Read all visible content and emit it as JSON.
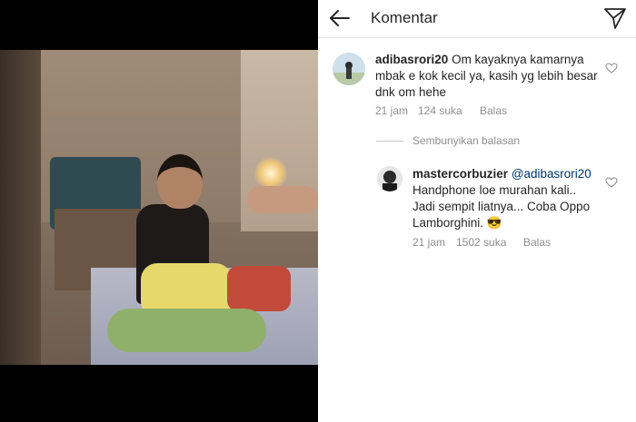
{
  "header": {
    "title": "Komentar"
  },
  "comments": [
    {
      "username": "adibasrori20",
      "text": "Om kayaknya kamarnya mbak e kok kecil ya, kasih yg lebih besar dnk om hehe",
      "time": "21 jam",
      "likes": "124 suka",
      "reply_label": "Balas"
    }
  ],
  "hide_replies_label": "Sembunyikan balasan",
  "replies": [
    {
      "username": "mastercorbuzier",
      "mention": "@adibasrori20",
      "text_line1": "Handphone loe murahan kali..",
      "text_line2": "Jadi sempit liatnya... Coba Oppo",
      "text_line3": "Lamborghini.",
      "emoji": "😎",
      "time": "21 jam",
      "likes": "1502 suka",
      "reply_label": "Balas"
    }
  ],
  "icons": {
    "back": "arrow-left-icon",
    "send": "paper-plane-icon",
    "like": "heart-outline-icon"
  },
  "colors": {
    "text": "#262626",
    "secondary": "#8e8e8e",
    "mention": "#003569"
  }
}
